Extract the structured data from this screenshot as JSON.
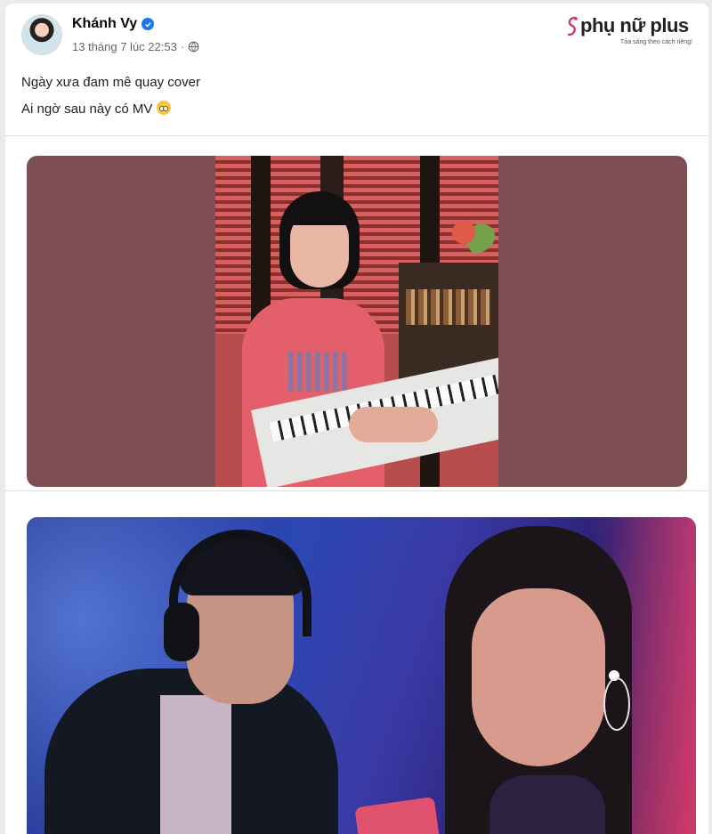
{
  "post": {
    "author": "Khánh Vy",
    "timestamp": "13 tháng 7 lúc 22:53",
    "separator": "·",
    "privacy_icon": "globe-icon",
    "verified_icon": "verified-badge-icon",
    "caption_lines": [
      "Ngày xưa đam mê quay cover",
      "Ai ngờ sau này có MV"
    ],
    "caption_emoji": "teary-face-emoji"
  },
  "brand": {
    "name": "phụ nữ plus",
    "tagline": "Tỏa sáng theo cách riêng!",
    "icon": "brand-mark-icon"
  },
  "colors": {
    "verified_blue": "#1877f2",
    "meta_gray": "#65676b",
    "brand_accent": "#d6336c"
  }
}
